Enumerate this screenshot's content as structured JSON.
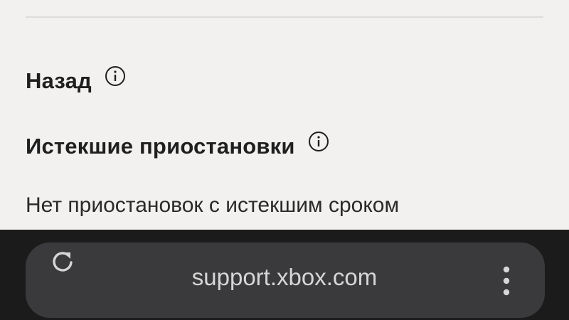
{
  "content": {
    "back_label": "Назад",
    "expired_label": "Истекшие приостановки",
    "no_expired_text": "Нет приостановок с истекшим сроком"
  },
  "browser": {
    "url": "support.xbox.com",
    "icons": {
      "reload": "reload-icon",
      "menu": "more-vert-icon",
      "info": "info-circle-icon"
    }
  },
  "colors": {
    "page_bg": "#f2f1ef",
    "text": "#1f1f1f",
    "bar_bg": "#1b1b1b",
    "pill_bg": "#3a3a3c",
    "url_text": "#d6d6d6"
  }
}
